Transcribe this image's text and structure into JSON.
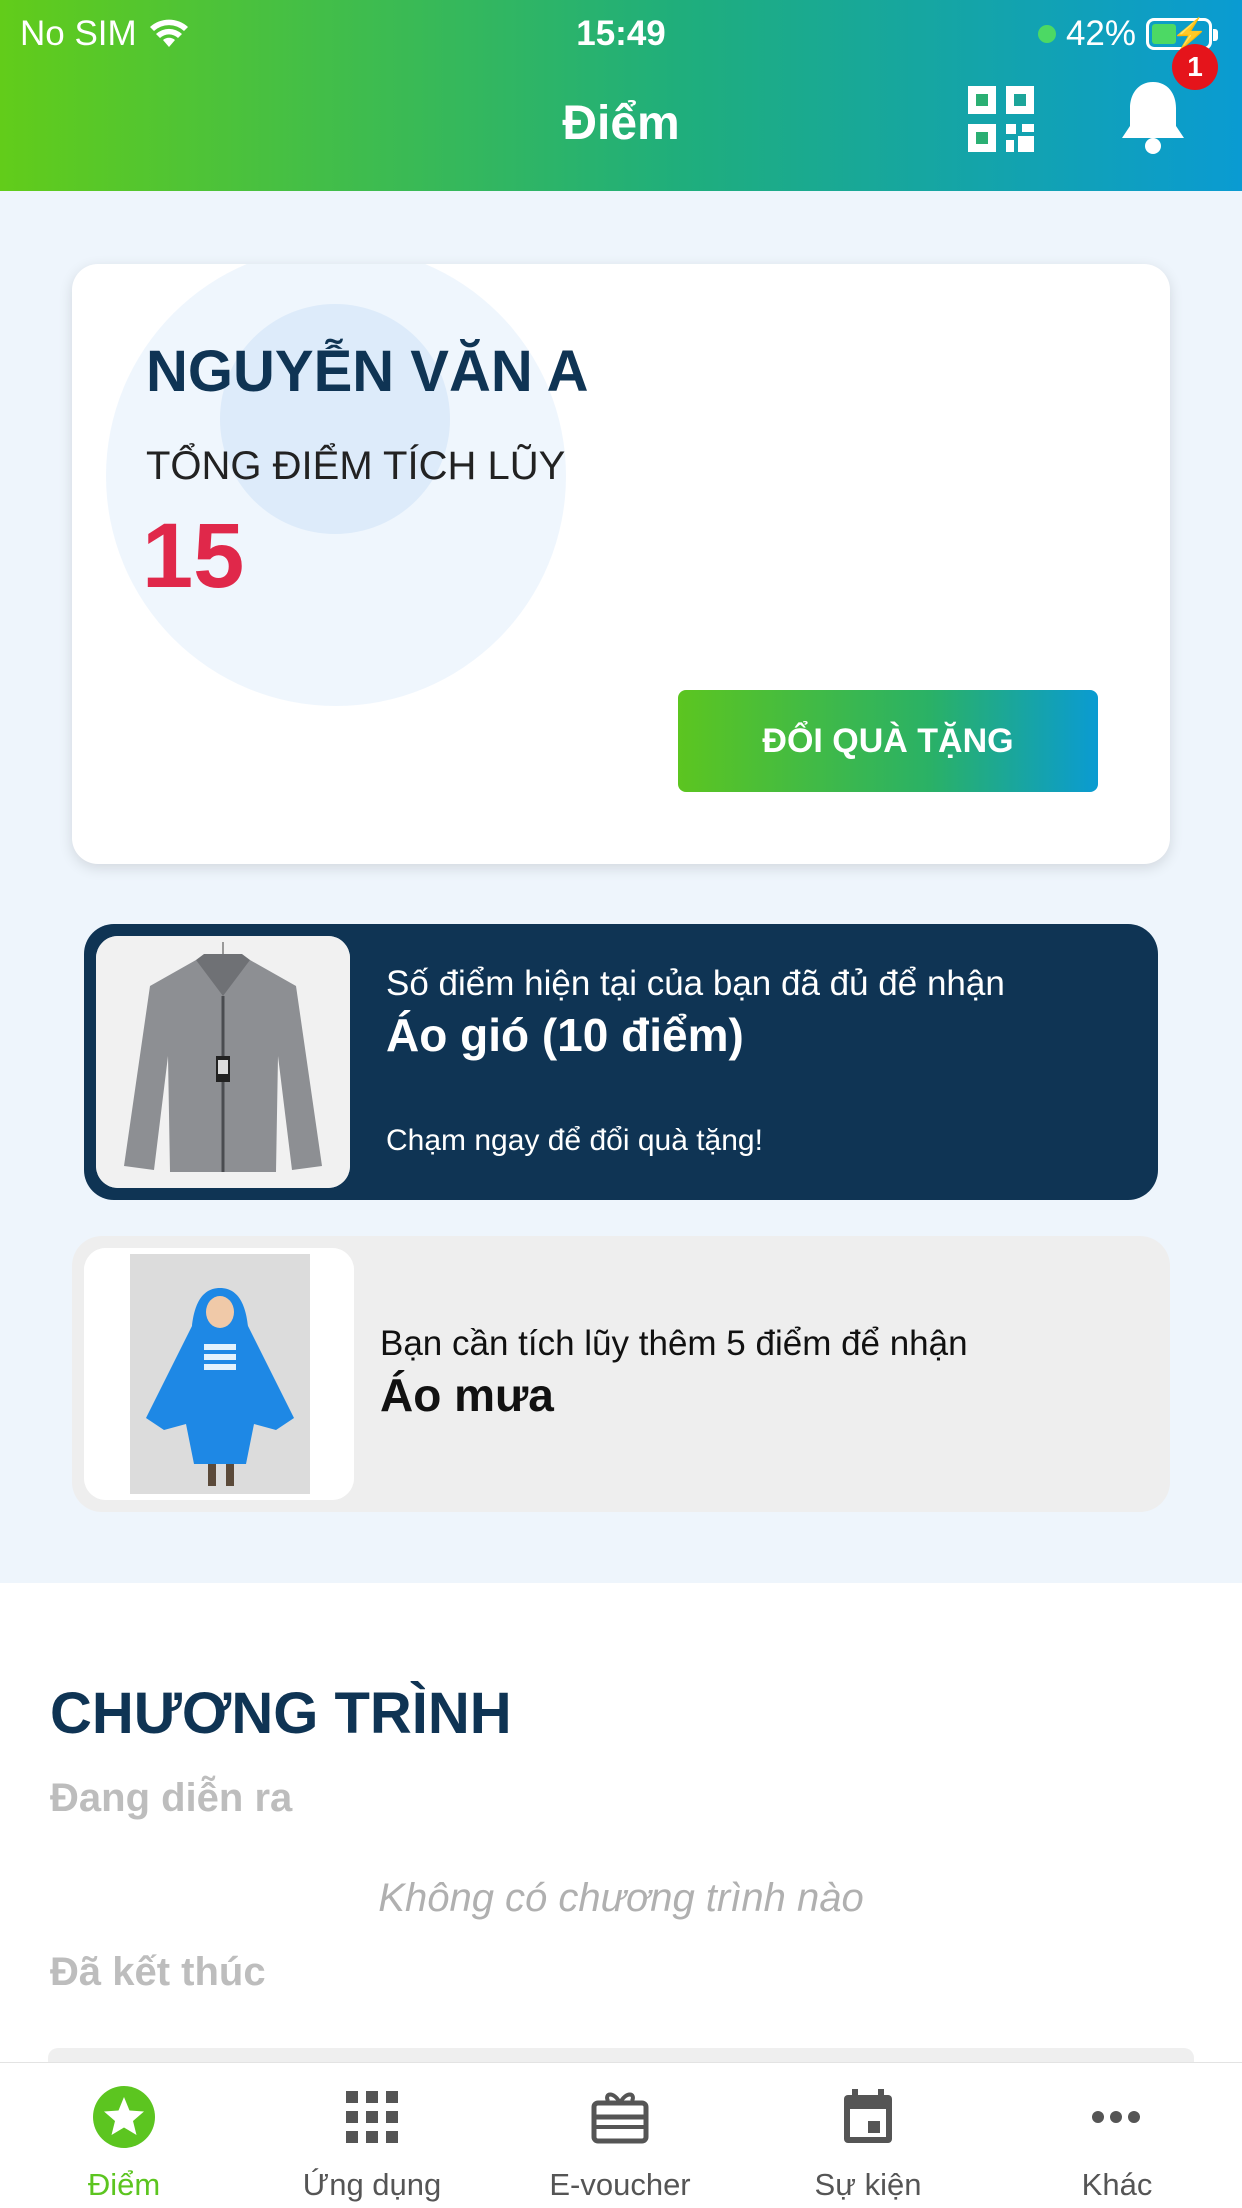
{
  "status_bar": {
    "carrier": "No SIM",
    "time": "15:49",
    "battery_percent": "42%"
  },
  "header": {
    "title": "Điểm",
    "notification_count": "1",
    "icons": [
      "qr-code-icon",
      "bell-icon"
    ],
    "gradient_colors": [
      "#62cc1a",
      "#0a9bd2"
    ]
  },
  "points_card": {
    "user_name": "NGUYỄN VĂN A",
    "total_label": "TỔNG ĐIỂM TÍCH LŨY",
    "total_value": "15",
    "redeem_button": "ĐỔI QUÀ TẶNG",
    "value_color": "#e0284a"
  },
  "gifts": [
    {
      "status": "available",
      "line1": "Số điểm hiện tại của bạn đã đủ để nhận",
      "name": "Áo gió (10 điểm)",
      "cta": "Chạm ngay để đổi quà tặng!",
      "image": "jacket-image"
    },
    {
      "status": "locked",
      "line1": "Bạn cần tích lũy thêm 5 điểm để nhận",
      "name": "Áo mưa",
      "image": "raincoat-image"
    }
  ],
  "programs": {
    "title": "CHƯƠNG TRÌNH",
    "ongoing_label": "Đang diễn ra",
    "empty_text": "Không có chương trình nào",
    "ended_label": "Đã kết thúc"
  },
  "tabs": [
    {
      "label": "Điểm",
      "icon": "star-icon",
      "active": true
    },
    {
      "label": "Ứng dụng",
      "icon": "apps-grid-icon",
      "active": false
    },
    {
      "label": "E-voucher",
      "icon": "gift-voucher-icon",
      "active": false
    },
    {
      "label": "Sự kiện",
      "icon": "calendar-icon",
      "active": false
    },
    {
      "label": "Khác",
      "icon": "more-icon",
      "active": false
    }
  ],
  "colors": {
    "navy": "#0f3454",
    "active_green": "#5cc520",
    "background": "#eef5fc"
  }
}
